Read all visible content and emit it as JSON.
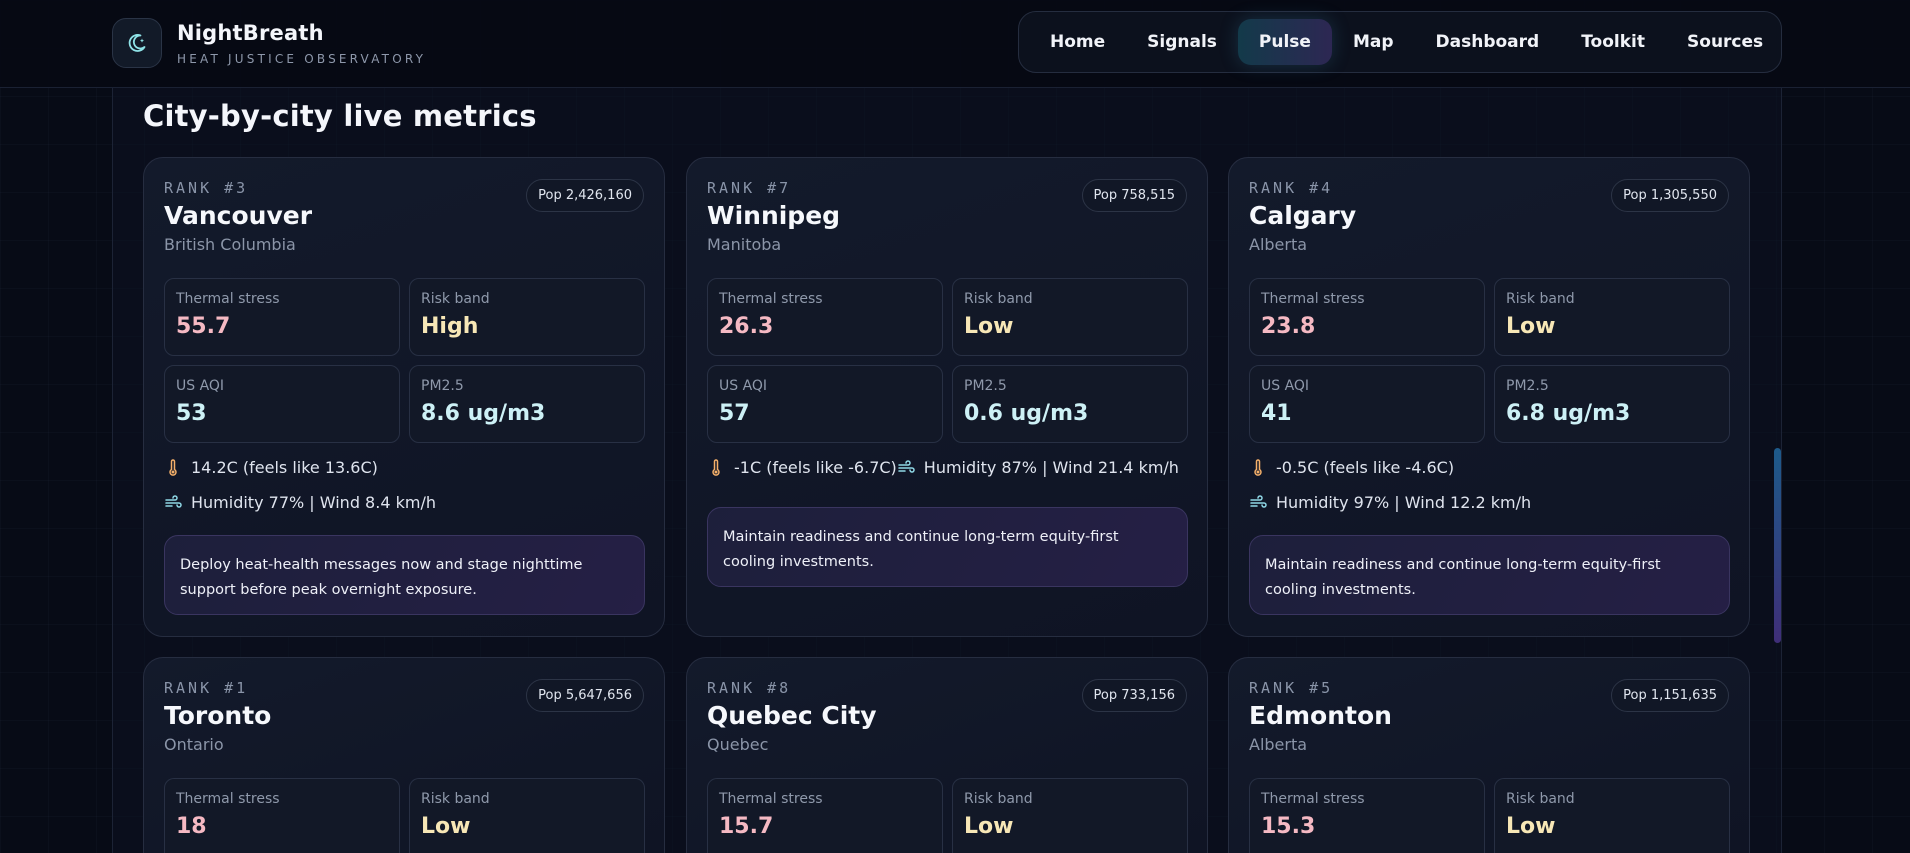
{
  "brand": {
    "name": "NightBreath",
    "subtitle": "HEAT JUSTICE OBSERVATORY"
  },
  "nav": [
    "Home",
    "Signals",
    "Pulse",
    "Map",
    "Dashboard",
    "Toolkit",
    "Sources"
  ],
  "nav_active": "Pulse",
  "section": {
    "title": "City-by-city live metrics"
  },
  "labels": {
    "thermal": "Thermal stress",
    "risk": "Risk band",
    "aqi": "US AQI",
    "pm": "PM2.5"
  },
  "cities": [
    {
      "rank": "RANK #3",
      "pop": "Pop 2,426,160",
      "name": "Vancouver",
      "province": "British Columbia",
      "thermal": "55.7",
      "risk": "High",
      "aqi": "53",
      "pm": "8.6 ug/m3",
      "temp": "14.2C (feels like 13.6C)",
      "wind": "Humidity 77% | Wind 8.4 km/h",
      "note": "Deploy heat-health messages now and stage nighttime support before peak overnight exposure."
    },
    {
      "rank": "RANK #7",
      "pop": "Pop 758,515",
      "name": "Winnipeg",
      "province": "Manitoba",
      "thermal": "26.3",
      "risk": "Low",
      "aqi": "57",
      "pm": "0.6 ug/m3",
      "temp": "-1C (feels like -6.7C)",
      "wind": "Humidity 87% | Wind 21.4 km/h",
      "note": "Maintain readiness and continue long-term equity-first cooling investments."
    },
    {
      "rank": "RANK #4",
      "pop": "Pop 1,305,550",
      "name": "Calgary",
      "province": "Alberta",
      "thermal": "23.8",
      "risk": "Low",
      "aqi": "41",
      "pm": "6.8 ug/m3",
      "temp": "-0.5C (feels like -4.6C)",
      "wind": "Humidity 97% | Wind 12.2 km/h",
      "note": "Maintain readiness and continue long-term equity-first cooling investments."
    },
    {
      "rank": "RANK #1",
      "pop": "Pop 5,647,656",
      "name": "Toronto",
      "province": "Ontario",
      "thermal": "18",
      "risk": "Low"
    },
    {
      "rank": "RANK #8",
      "pop": "Pop 733,156",
      "name": "Quebec City",
      "province": "Quebec",
      "thermal": "15.7",
      "risk": "Low"
    },
    {
      "rank": "RANK #5",
      "pop": "Pop 1,151,635",
      "name": "Edmonton",
      "province": "Alberta",
      "thermal": "15.3",
      "risk": "Low"
    }
  ]
}
